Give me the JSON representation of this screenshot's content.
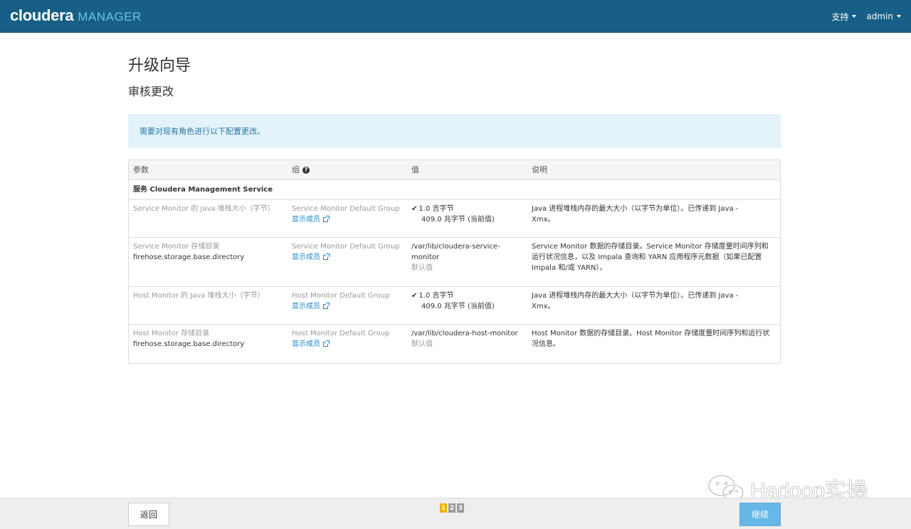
{
  "navbar": {
    "brand_primary": "cloudera",
    "brand_secondary": "MANAGER",
    "support_label": "支持",
    "user_label": "admin"
  },
  "page": {
    "title": "升级向导",
    "subtitle": "审核更改",
    "info_message": "需要对现有角色进行以下配置更改。"
  },
  "table": {
    "headers": [
      "参数",
      "组",
      "值",
      "说明"
    ],
    "service_row": "服务 Cloudera Management Service",
    "rows": [
      {
        "param": "Service Monitor 的 Java 堆栈大小（字节）",
        "param_key": "",
        "group": "Service Monitor Default Group",
        "group_link": "显示成员",
        "value_new": "1.0 吉字节",
        "value_old": "409.0 兆字节 (当前值)",
        "description_line1": "Java 进程堆栈内存的最大大小（以字节为单位）。已传递到 Java -",
        "description_line2": "Xmx。",
        "description_line3": ""
      },
      {
        "param": "Service Monitor 存储目录",
        "param_key": "firehose.storage.base.directory",
        "group": "Service Monitor Default Group",
        "group_link": "显示成员",
        "value_new": "/var/lib/cloudera-service-monitor",
        "value_old": "默认值",
        "description_line1": "Service Monitor 数据的存储目录。Service Monitor 存储度量时间序列和",
        "description_line2": "运行状况信息，以及 Impala 查询和 YARN 应用程序元数据（如果已配置",
        "description_line3": "Impala 和/或 YARN）。"
      },
      {
        "param": "Host Monitor 的 Java 堆栈大小（字节）",
        "param_key": "",
        "group": "Host Monitor Default Group",
        "group_link": "显示成员",
        "value_new": "1.0 吉字节",
        "value_old": "409.0 兆字节 (当前值)",
        "description_line1": "Java 进程堆栈内存的最大大小（以字节为单位）。已传递到 Java -",
        "description_line2": "Xmx。",
        "description_line3": ""
      },
      {
        "param": "Host Monitor 存储目录",
        "param_key": "firehose.storage.base.directory",
        "group": "Host Monitor Default Group",
        "group_link": "显示成员",
        "value_new": "/var/lib/cloudera-host-monitor",
        "value_old": "默认值",
        "description_line1": "Host Monitor 数据的存储目录。Host Monitor 存储度量时间序列和运行状",
        "description_line2": "况信息。",
        "description_line3": ""
      }
    ]
  },
  "footer": {
    "back_label": "返回",
    "continue_label": "继续",
    "steps": [
      "1",
      "2",
      "3"
    ],
    "active_step": "1"
  },
  "watermark": {
    "text": "Hadoop实操"
  },
  "colors": {
    "navbar": "#175f86",
    "info_bg": "#e4f3fa",
    "link": "#1a86c8",
    "continue_button": "#67b7e6",
    "active_step": "#f0b000"
  }
}
